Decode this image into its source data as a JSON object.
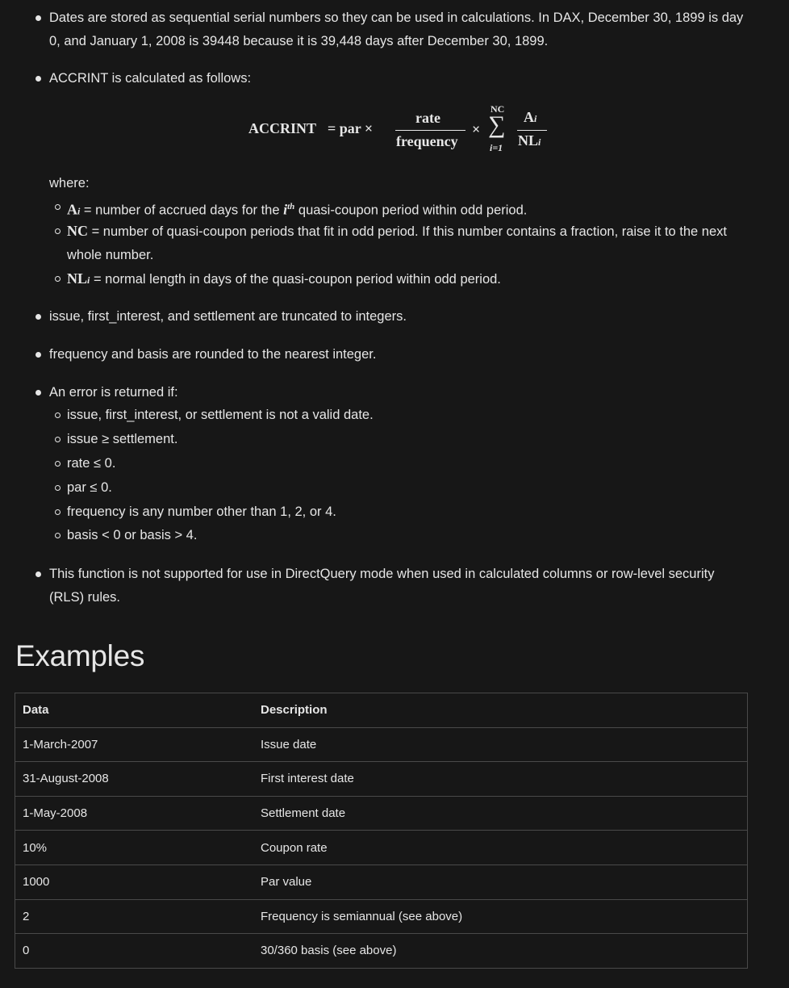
{
  "bullets": {
    "dates": "Dates are stored as sequential serial numbers so they can be used in calculations. In DAX, December 30, 1899 is day 0, and January 1, 2008 is 39448 because it is 39,448 days after December 30, 1899.",
    "calc_intro": "ACCRINT is calculated as follows:",
    "where": "where:",
    "where_items": [
      {
        "sym": "A",
        "sub": "i",
        "text_a": " = number of accrued days for the ",
        "sup_base": "i",
        "sup": "th",
        "text_b": " quasi-coupon period within odd period."
      },
      {
        "sym": "NC",
        "text": " = number of quasi-coupon periods that fit in odd period. If this number contains a fraction, raise it to the next whole number."
      },
      {
        "sym": "NL",
        "sub": "i",
        "text": " = normal length in days of the quasi-coupon period within odd period."
      }
    ],
    "truncated": "issue, first_interest, and settlement are truncated to integers.",
    "rounded": "frequency and basis are rounded to the nearest integer.",
    "error_intro": "An error is returned if:",
    "error_items": [
      "issue, first_interest, or settlement is not a valid date.",
      "issue ≥ settlement.",
      "rate ≤ 0.",
      "par ≤ 0.",
      "frequency is any number other than 1, 2, or 4.",
      "basis < 0 or basis > 4."
    ],
    "directquery": "This function is not supported for use in DirectQuery mode when used in calculated columns or row-level security (RLS) rules."
  },
  "formula": {
    "lhs": "ACCRINT",
    "eq_par": "= par ×",
    "num": "rate",
    "den": "frequency",
    "times": "×",
    "sigma": "∑",
    "upper": "NC",
    "lower": "i=1",
    "frac2_num": "A",
    "frac2_num_sub": "i",
    "frac2_den": "NL",
    "frac2_den_sub": "i"
  },
  "examples": {
    "heading": "Examples",
    "headers": [
      "Data",
      "Description"
    ],
    "rows": [
      [
        "1-March-2007",
        "Issue date"
      ],
      [
        "31-August-2008",
        "First interest date"
      ],
      [
        "1-May-2008",
        "Settlement date"
      ],
      [
        "10%",
        "Coupon rate"
      ],
      [
        "1000",
        "Par value"
      ],
      [
        "2",
        "Frequency is semiannual (see above)"
      ],
      [
        "0",
        "30/360 basis (see above)"
      ]
    ]
  }
}
